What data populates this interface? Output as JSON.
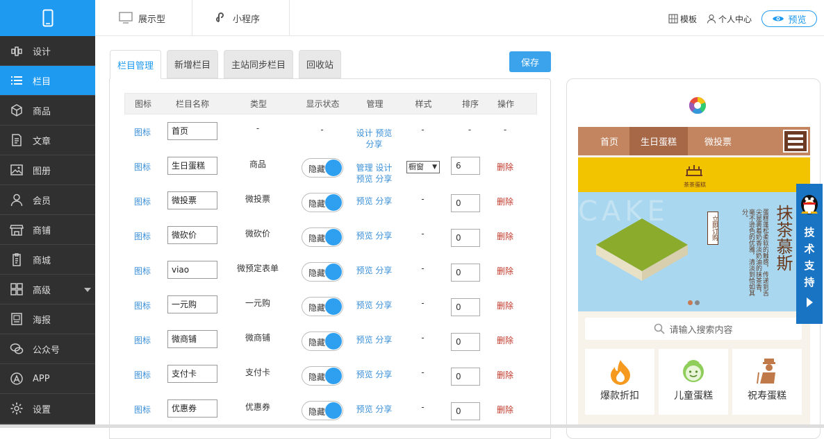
{
  "topbar": {
    "mode_display": "展示型",
    "mode_miniprogram": "小程序",
    "template": "模板",
    "personal": "个人中心",
    "preview": "预览"
  },
  "sidebar": {
    "items": [
      {
        "label": "设计",
        "icon": "design-icon"
      },
      {
        "label": "栏目",
        "icon": "list-icon",
        "active": true
      },
      {
        "label": "商品",
        "icon": "box-icon"
      },
      {
        "label": "文章",
        "icon": "article-icon"
      },
      {
        "label": "图册",
        "icon": "image-icon"
      },
      {
        "label": "会员",
        "icon": "user-icon"
      },
      {
        "label": "商铺",
        "icon": "shop-icon"
      },
      {
        "label": "商城",
        "icon": "clipboard-icon"
      },
      {
        "label": "高级",
        "icon": "grid-icon"
      },
      {
        "label": "海报",
        "icon": "poster-icon"
      },
      {
        "label": "公众号",
        "icon": "wechat-icon"
      },
      {
        "label": "APP",
        "icon": "app-icon"
      },
      {
        "label": "设置",
        "icon": "gear-icon"
      }
    ]
  },
  "tabs": [
    "栏目管理",
    "新增栏目",
    "主站同步栏目",
    "回收站"
  ],
  "save_label": "保存",
  "table": {
    "headers": [
      "图标",
      "栏目名称",
      "类型",
      "显示状态",
      "管理",
      "样式",
      "排序",
      "操作"
    ],
    "rows": [
      {
        "icon": "图标",
        "name": "首页",
        "type": "-",
        "status": "-",
        "manage1": "设计 预览",
        "manage2": "分享",
        "style": "-",
        "order": "-",
        "action": "-"
      },
      {
        "icon": "图标",
        "name": "生日蛋糕",
        "type": "商品",
        "status": "隐藏",
        "manage1": "管理 设计",
        "manage2": "预览 分享",
        "style": "橱窗",
        "order": "6",
        "action": "删除"
      },
      {
        "icon": "图标",
        "name": "微投票",
        "type": "微投票",
        "status": "隐藏",
        "manage1": "预览 分享",
        "manage2": "",
        "style": "-",
        "order": "0",
        "action": "删除"
      },
      {
        "icon": "图标",
        "name": "微砍价",
        "type": "微砍价",
        "status": "隐藏",
        "manage1": "预览 分享",
        "manage2": "",
        "style": "-",
        "order": "0",
        "action": "删除"
      },
      {
        "icon": "图标",
        "name": "viao",
        "type": "微预定表单",
        "status": "隐藏",
        "manage1": "预览 分享",
        "manage2": "",
        "style": "-",
        "order": "0",
        "action": "删除"
      },
      {
        "icon": "图标",
        "name": "一元购",
        "type": "一元购",
        "status": "隐藏",
        "manage1": "预览 分享",
        "manage2": "",
        "style": "-",
        "order": "0",
        "action": "删除"
      },
      {
        "icon": "图标",
        "name": "微商铺",
        "type": "微商铺",
        "status": "隐藏",
        "manage1": "预览 分享",
        "manage2": "",
        "style": "-",
        "order": "0",
        "action": "删除"
      },
      {
        "icon": "图标",
        "name": "支付卡",
        "type": "支付卡",
        "status": "隐藏",
        "manage1": "预览 分享",
        "manage2": "",
        "style": "-",
        "order": "0",
        "action": "删除"
      },
      {
        "icon": "图标",
        "name": "优惠券",
        "type": "优惠券",
        "status": "隐藏",
        "manage1": "预览 分享",
        "manage2": "",
        "style": "-",
        "order": "0",
        "action": "删除"
      }
    ]
  },
  "phone": {
    "nav": [
      "首页",
      "生日蛋糕",
      "微投票"
    ],
    "banner_brand": "茶茶蛋糕",
    "banner_title": "抹茶慕斯",
    "banner_button": "立即订购",
    "banner_text": "蛋糕蓬松柔软的触感，传递到舌尖是裹着奶香淡奶油的抹茶香，毫不逊色的优雅，清淡到恰如其分。",
    "search_placeholder": "请输入搜索内容",
    "categories": [
      "爆款折扣",
      "儿童蛋糕",
      "祝寿蛋糕"
    ]
  },
  "tech_support": "技术支持"
}
